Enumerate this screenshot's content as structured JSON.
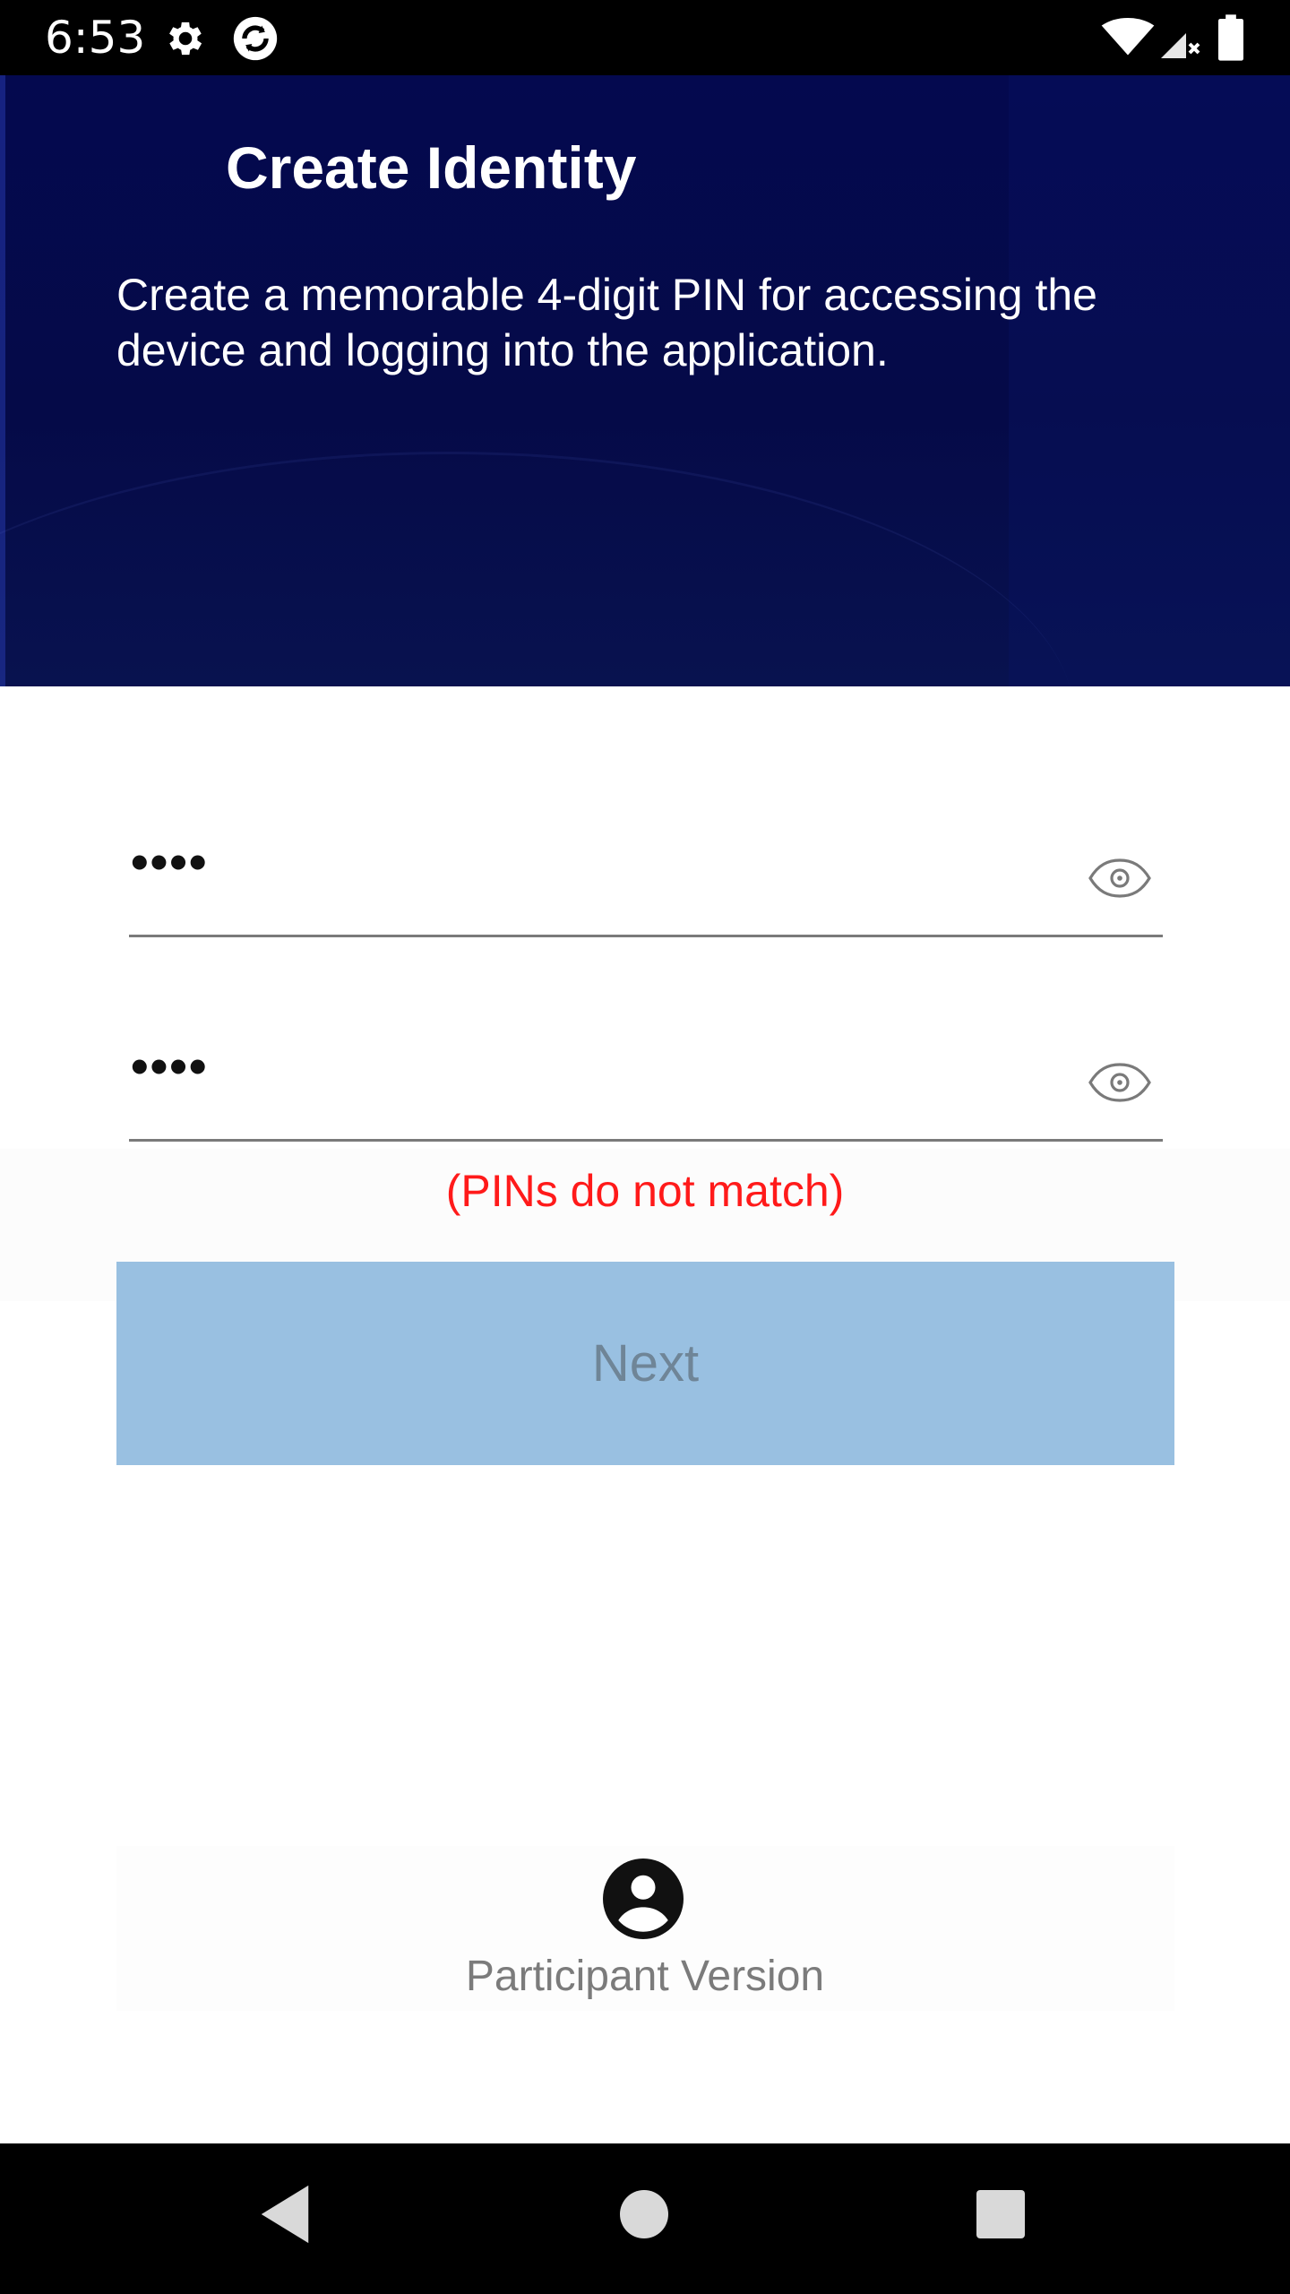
{
  "status_bar": {
    "time": "6:53",
    "icons": [
      "gear-icon",
      "app-sync-icon",
      "wifi-icon",
      "cell-signal-icon",
      "battery-icon"
    ]
  },
  "header": {
    "title": "Create Identity",
    "description": "Create a memorable 4-digit PIN for accessing the device and logging into the application."
  },
  "form": {
    "pin_field": {
      "value": "••••",
      "icon": "eye-icon"
    },
    "confirm_pin_field": {
      "value": "••••",
      "icon": "eye-icon"
    },
    "error_message": "(PINs do not match)",
    "next_button_label": "Next"
  },
  "footer": {
    "icon": "account-circle-icon",
    "version_label": "Participant Version"
  },
  "nav_bar": {
    "buttons": [
      "back-icon",
      "home-icon",
      "recents-icon"
    ]
  },
  "colors": {
    "header_background": "#050a48",
    "error": "#ff1a1a",
    "button_disabled_background": "#99c0e1",
    "button_disabled_text": "#6f8597",
    "underline": "#7a7a7a"
  }
}
